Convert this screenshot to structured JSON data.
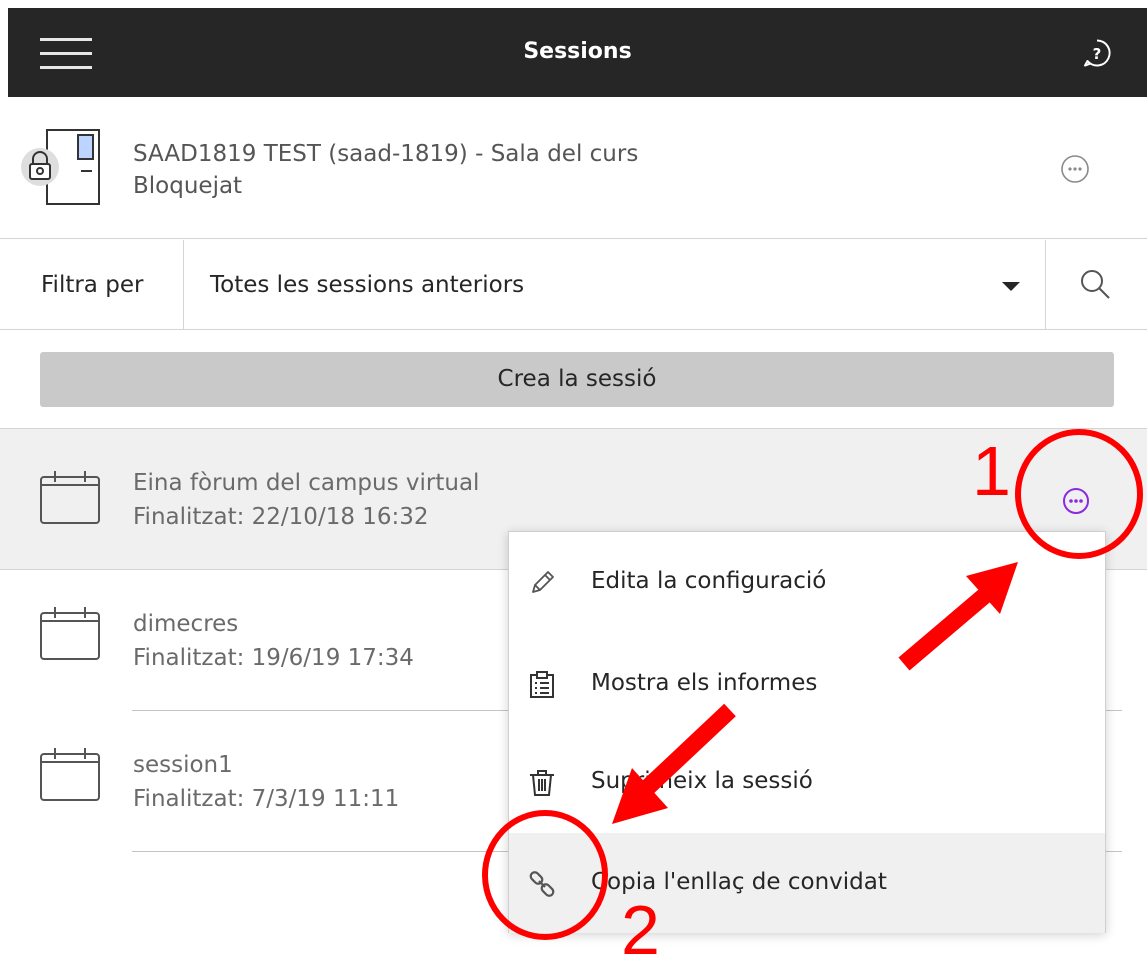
{
  "header": {
    "title": "Sessions",
    "icons": {
      "menu": "hamburger-menu-icon",
      "help": "help-icon"
    }
  },
  "room": {
    "name": "SAAD1819 TEST (saad-1819) - Sala del curs",
    "status": "Bloquejat",
    "icon": "locked-door-icon"
  },
  "filter": {
    "label": "Filtra per",
    "value": "Totes les sessions anteriors"
  },
  "create_button": {
    "label": "Crea la sessió"
  },
  "sessions": [
    {
      "name": "Eina fòrum del campus virtual",
      "time": "Finalitzat: 22/10/18 16:32",
      "selected": true
    },
    {
      "name": "dimecres",
      "time": "Finalitzat: 19/6/19 17:34",
      "selected": false
    },
    {
      "name": "session1",
      "time": "Finalitzat: 7/3/19 11:11",
      "selected": false
    }
  ],
  "context_menu": {
    "items": [
      {
        "label": "Edita la configuració",
        "icon": "pencil-icon"
      },
      {
        "label": "Mostra els informes",
        "icon": "report-clipboard-icon"
      },
      {
        "label": "Suprimeix la sessió",
        "icon": "trash-icon"
      },
      {
        "label": "Copia l'enllaç de convidat",
        "icon": "link-icon",
        "highlighted": true
      }
    ]
  },
  "annotations": {
    "step1": "1",
    "step2": "2",
    "color": "#ff0000"
  },
  "colors": {
    "header_bg": "#262626",
    "accent": "#8a2be2",
    "selected_row": "#f0f0f0",
    "button_bg": "#c9c9c9"
  }
}
